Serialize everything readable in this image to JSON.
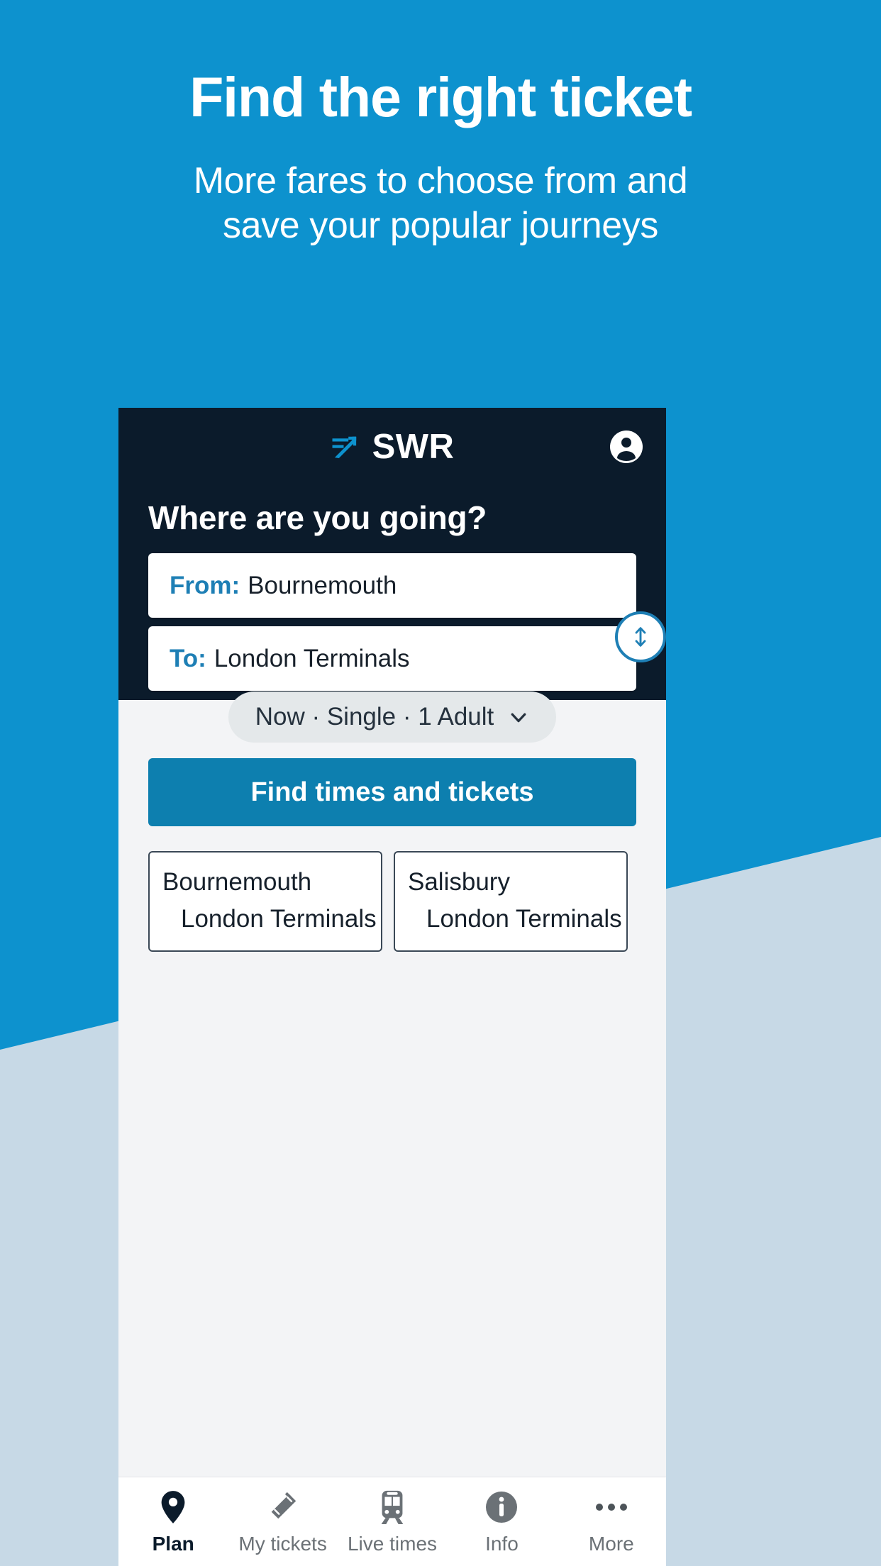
{
  "promo": {
    "title": "Find the right ticket",
    "subtitle_line1": "More fares to choose from and",
    "subtitle_line2": "save your popular journeys"
  },
  "colors": {
    "brand_blue": "#0d92ce",
    "bg_lower": "#c7d9e6",
    "app_dark": "#0b1b2b",
    "accent": "#1e7fb5",
    "cta": "#0d7faf",
    "content_bg": "#f3f4f6"
  },
  "app": {
    "brand_name": "SWR",
    "brand_mark_icon": "swr-arrow-icon",
    "account_icon": "account-circle-icon",
    "heading": "Where are you going?",
    "search": {
      "from_label": "From:",
      "from_value": "Bournemouth",
      "to_label": "To:",
      "to_value": "London Terminals",
      "swap_icon": "swap-vertical-icon"
    },
    "options": {
      "text": "Now · Single · 1 Adult",
      "chevron_icon": "chevron-down-icon"
    },
    "cta_label": "Find times and tickets",
    "recent_journeys": [
      {
        "from": "Bournemouth",
        "to": "London Terminals",
        "arrow_icon": "arrow-right-icon"
      },
      {
        "from": "Salisbury",
        "to": "London Terminals",
        "arrow_icon": "arrow-right-icon"
      }
    ],
    "bottom_nav": [
      {
        "label": "Plan",
        "icon": "map-pin-icon",
        "active": true
      },
      {
        "label": "My tickets",
        "icon": "ticket-icon",
        "active": false
      },
      {
        "label": "Live times",
        "icon": "train-icon",
        "active": false
      },
      {
        "label": "Info",
        "icon": "info-circle-icon",
        "active": false
      },
      {
        "label": "More",
        "icon": "ellipsis-icon",
        "active": false
      }
    ]
  }
}
